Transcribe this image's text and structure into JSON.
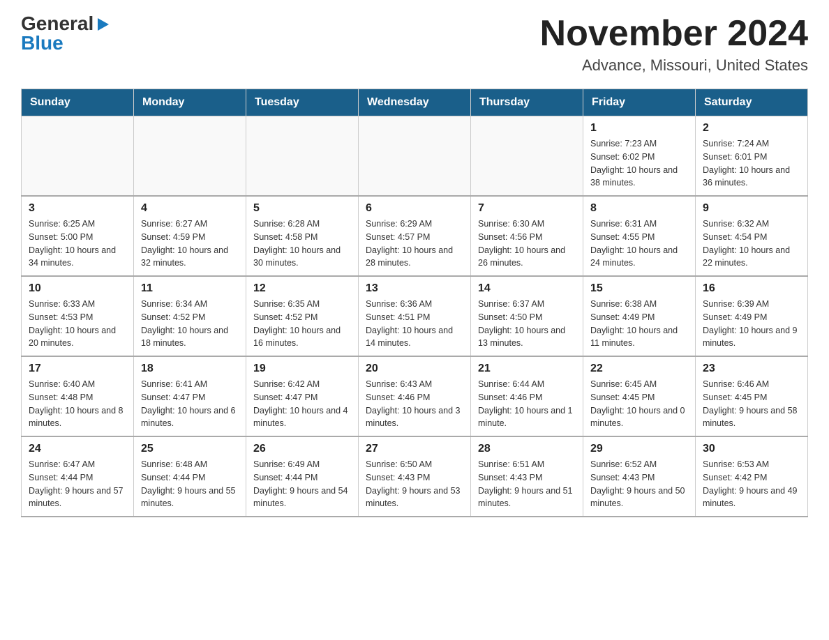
{
  "logo": {
    "general": "General",
    "blue": "Blue"
  },
  "title": "November 2024",
  "location": "Advance, Missouri, United States",
  "days_of_week": [
    "Sunday",
    "Monday",
    "Tuesday",
    "Wednesday",
    "Thursday",
    "Friday",
    "Saturday"
  ],
  "weeks": [
    [
      {
        "day": "",
        "info": ""
      },
      {
        "day": "",
        "info": ""
      },
      {
        "day": "",
        "info": ""
      },
      {
        "day": "",
        "info": ""
      },
      {
        "day": "",
        "info": ""
      },
      {
        "day": "1",
        "info": "Sunrise: 7:23 AM\nSunset: 6:02 PM\nDaylight: 10 hours and 38 minutes."
      },
      {
        "day": "2",
        "info": "Sunrise: 7:24 AM\nSunset: 6:01 PM\nDaylight: 10 hours and 36 minutes."
      }
    ],
    [
      {
        "day": "3",
        "info": "Sunrise: 6:25 AM\nSunset: 5:00 PM\nDaylight: 10 hours and 34 minutes."
      },
      {
        "day": "4",
        "info": "Sunrise: 6:27 AM\nSunset: 4:59 PM\nDaylight: 10 hours and 32 minutes."
      },
      {
        "day": "5",
        "info": "Sunrise: 6:28 AM\nSunset: 4:58 PM\nDaylight: 10 hours and 30 minutes."
      },
      {
        "day": "6",
        "info": "Sunrise: 6:29 AM\nSunset: 4:57 PM\nDaylight: 10 hours and 28 minutes."
      },
      {
        "day": "7",
        "info": "Sunrise: 6:30 AM\nSunset: 4:56 PM\nDaylight: 10 hours and 26 minutes."
      },
      {
        "day": "8",
        "info": "Sunrise: 6:31 AM\nSunset: 4:55 PM\nDaylight: 10 hours and 24 minutes."
      },
      {
        "day": "9",
        "info": "Sunrise: 6:32 AM\nSunset: 4:54 PM\nDaylight: 10 hours and 22 minutes."
      }
    ],
    [
      {
        "day": "10",
        "info": "Sunrise: 6:33 AM\nSunset: 4:53 PM\nDaylight: 10 hours and 20 minutes."
      },
      {
        "day": "11",
        "info": "Sunrise: 6:34 AM\nSunset: 4:52 PM\nDaylight: 10 hours and 18 minutes."
      },
      {
        "day": "12",
        "info": "Sunrise: 6:35 AM\nSunset: 4:52 PM\nDaylight: 10 hours and 16 minutes."
      },
      {
        "day": "13",
        "info": "Sunrise: 6:36 AM\nSunset: 4:51 PM\nDaylight: 10 hours and 14 minutes."
      },
      {
        "day": "14",
        "info": "Sunrise: 6:37 AM\nSunset: 4:50 PM\nDaylight: 10 hours and 13 minutes."
      },
      {
        "day": "15",
        "info": "Sunrise: 6:38 AM\nSunset: 4:49 PM\nDaylight: 10 hours and 11 minutes."
      },
      {
        "day": "16",
        "info": "Sunrise: 6:39 AM\nSunset: 4:49 PM\nDaylight: 10 hours and 9 minutes."
      }
    ],
    [
      {
        "day": "17",
        "info": "Sunrise: 6:40 AM\nSunset: 4:48 PM\nDaylight: 10 hours and 8 minutes."
      },
      {
        "day": "18",
        "info": "Sunrise: 6:41 AM\nSunset: 4:47 PM\nDaylight: 10 hours and 6 minutes."
      },
      {
        "day": "19",
        "info": "Sunrise: 6:42 AM\nSunset: 4:47 PM\nDaylight: 10 hours and 4 minutes."
      },
      {
        "day": "20",
        "info": "Sunrise: 6:43 AM\nSunset: 4:46 PM\nDaylight: 10 hours and 3 minutes."
      },
      {
        "day": "21",
        "info": "Sunrise: 6:44 AM\nSunset: 4:46 PM\nDaylight: 10 hours and 1 minute."
      },
      {
        "day": "22",
        "info": "Sunrise: 6:45 AM\nSunset: 4:45 PM\nDaylight: 10 hours and 0 minutes."
      },
      {
        "day": "23",
        "info": "Sunrise: 6:46 AM\nSunset: 4:45 PM\nDaylight: 9 hours and 58 minutes."
      }
    ],
    [
      {
        "day": "24",
        "info": "Sunrise: 6:47 AM\nSunset: 4:44 PM\nDaylight: 9 hours and 57 minutes."
      },
      {
        "day": "25",
        "info": "Sunrise: 6:48 AM\nSunset: 4:44 PM\nDaylight: 9 hours and 55 minutes."
      },
      {
        "day": "26",
        "info": "Sunrise: 6:49 AM\nSunset: 4:44 PM\nDaylight: 9 hours and 54 minutes."
      },
      {
        "day": "27",
        "info": "Sunrise: 6:50 AM\nSunset: 4:43 PM\nDaylight: 9 hours and 53 minutes."
      },
      {
        "day": "28",
        "info": "Sunrise: 6:51 AM\nSunset: 4:43 PM\nDaylight: 9 hours and 51 minutes."
      },
      {
        "day": "29",
        "info": "Sunrise: 6:52 AM\nSunset: 4:43 PM\nDaylight: 9 hours and 50 minutes."
      },
      {
        "day": "30",
        "info": "Sunrise: 6:53 AM\nSunset: 4:42 PM\nDaylight: 9 hours and 49 minutes."
      }
    ]
  ]
}
